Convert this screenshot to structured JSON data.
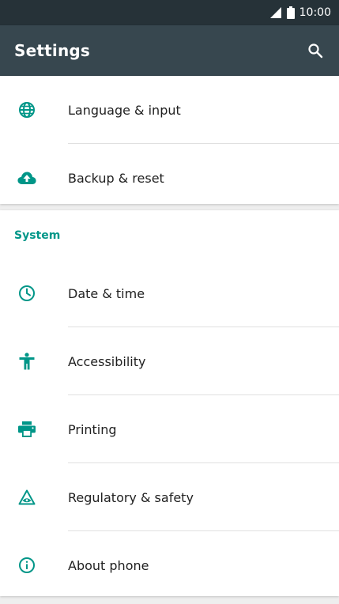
{
  "status_bar": {
    "time": "10:00",
    "icons": [
      "signal-icon",
      "battery-icon"
    ]
  },
  "app_bar": {
    "title": "Settings",
    "search_icon": "search-icon"
  },
  "colors": {
    "accent": "#009688",
    "app_bar": "#37474f",
    "status_bar": "#263238"
  },
  "top_group": {
    "items": [
      {
        "label": "Language & input",
        "icon": "globe-icon"
      },
      {
        "label": "Backup & reset",
        "icon": "cloud-upload-icon"
      }
    ]
  },
  "system": {
    "header": "System",
    "items": [
      {
        "label": "Date & time",
        "icon": "clock-icon"
      },
      {
        "label": "Accessibility",
        "icon": "accessibility-icon"
      },
      {
        "label": "Printing",
        "icon": "printer-icon"
      },
      {
        "label": "Regulatory & safety",
        "icon": "regulatory-icon"
      },
      {
        "label": "About phone",
        "icon": "info-icon"
      }
    ]
  }
}
